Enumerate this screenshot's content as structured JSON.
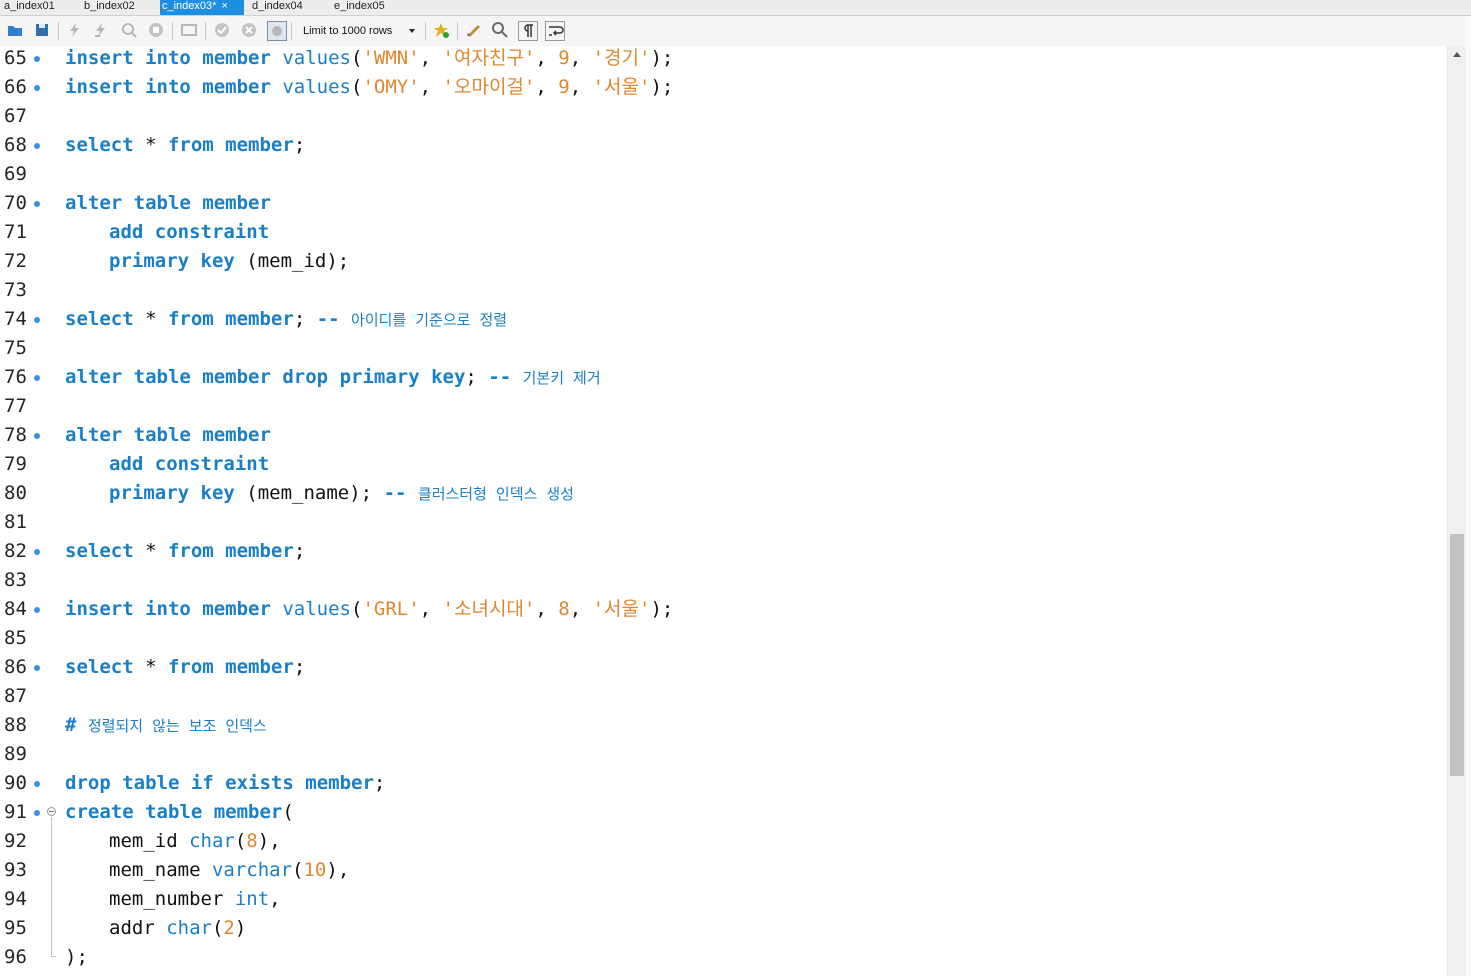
{
  "tabs": [
    {
      "label": "a_index01",
      "active": false
    },
    {
      "label": "b_index02",
      "active": false
    },
    {
      "label": "c_index03*",
      "active": true,
      "close": "×"
    },
    {
      "label": "d_index04",
      "active": false
    },
    {
      "label": "e_index05",
      "active": false
    }
  ],
  "toolbar": {
    "icons": [
      "open-folder-icon",
      "save-icon",
      "execute-icon",
      "execute-current-icon",
      "explain-icon",
      "stop-icon",
      "toggle-results-icon",
      "commit-icon",
      "rollback-icon",
      "autocommit-icon",
      "bookmark-icon",
      "beautify-icon",
      "find-icon",
      "invisible-chars-icon",
      "wrap-icon"
    ],
    "limit_label": "Limit to 1000 rows"
  },
  "editor": {
    "lines": [
      {
        "n": "65",
        "marker": true,
        "tokens": [
          [
            "kw",
            "insert "
          ],
          [
            "kw",
            "into "
          ],
          [
            "kw",
            "member "
          ],
          [
            "fn",
            "values"
          ],
          [
            "pl",
            "("
          ],
          [
            "str",
            "'WMN'"
          ],
          [
            "pl",
            ", "
          ],
          [
            "str",
            "'여자친구'"
          ],
          [
            "pl",
            ", "
          ],
          [
            "num",
            "9"
          ],
          [
            "pl",
            ", "
          ],
          [
            "str",
            "'경기'"
          ],
          [
            "pl",
            ");"
          ]
        ]
      },
      {
        "n": "66",
        "marker": true,
        "tokens": [
          [
            "kw",
            "insert "
          ],
          [
            "kw",
            "into "
          ],
          [
            "kw",
            "member "
          ],
          [
            "fn",
            "values"
          ],
          [
            "pl",
            "("
          ],
          [
            "str",
            "'OMY'"
          ],
          [
            "pl",
            ", "
          ],
          [
            "str",
            "'오마이걸'"
          ],
          [
            "pl",
            ", "
          ],
          [
            "num",
            "9"
          ],
          [
            "pl",
            ", "
          ],
          [
            "str",
            "'서울'"
          ],
          [
            "pl",
            ");"
          ]
        ]
      },
      {
        "n": "67",
        "marker": false,
        "tokens": []
      },
      {
        "n": "68",
        "marker": true,
        "tokens": [
          [
            "kw",
            "select "
          ],
          [
            "pl",
            "* "
          ],
          [
            "kw",
            "from "
          ],
          [
            "kw",
            "member"
          ],
          [
            "pl",
            ";"
          ]
        ]
      },
      {
        "n": "69",
        "marker": false,
        "tokens": []
      },
      {
        "n": "70",
        "marker": true,
        "tokens": [
          [
            "kw",
            "alter "
          ],
          [
            "kw",
            "table "
          ],
          [
            "kw",
            "member"
          ]
        ]
      },
      {
        "n": "71",
        "marker": false,
        "indent": true,
        "tokens": [
          [
            "kw",
            "add "
          ],
          [
            "kw",
            "constraint"
          ]
        ]
      },
      {
        "n": "72",
        "marker": false,
        "indent": true,
        "tokens": [
          [
            "kw",
            "primary "
          ],
          [
            "kw",
            "key "
          ],
          [
            "pl",
            "(mem_id);"
          ]
        ]
      },
      {
        "n": "73",
        "marker": false,
        "tokens": []
      },
      {
        "n": "74",
        "marker": true,
        "tokens": [
          [
            "kw",
            "select "
          ],
          [
            "pl",
            "* "
          ],
          [
            "kw",
            "from "
          ],
          [
            "kw",
            "member"
          ],
          [
            "pl",
            "; "
          ],
          [
            "kw",
            "-- "
          ],
          [
            "cm",
            "아이디를 기준으로 정렬"
          ]
        ]
      },
      {
        "n": "75",
        "marker": false,
        "tokens": []
      },
      {
        "n": "76",
        "marker": true,
        "tokens": [
          [
            "kw",
            "alter "
          ],
          [
            "kw",
            "table "
          ],
          [
            "kw",
            "member "
          ],
          [
            "kw",
            "drop "
          ],
          [
            "kw",
            "primary "
          ],
          [
            "kw",
            "key"
          ],
          [
            "pl",
            "; "
          ],
          [
            "kw",
            "-- "
          ],
          [
            "cm",
            "기본키 제거"
          ]
        ]
      },
      {
        "n": "77",
        "marker": false,
        "tokens": []
      },
      {
        "n": "78",
        "marker": true,
        "tokens": [
          [
            "kw",
            "alter "
          ],
          [
            "kw",
            "table "
          ],
          [
            "kw",
            "member"
          ]
        ]
      },
      {
        "n": "79",
        "marker": false,
        "indent": true,
        "tokens": [
          [
            "kw",
            "add "
          ],
          [
            "kw",
            "constraint"
          ]
        ]
      },
      {
        "n": "80",
        "marker": false,
        "indent": true,
        "tokens": [
          [
            "kw",
            "primary "
          ],
          [
            "kw",
            "key "
          ],
          [
            "pl",
            "(mem_name); "
          ],
          [
            "kw",
            "-- "
          ],
          [
            "cm",
            "클러스터형 인덱스 생성"
          ]
        ]
      },
      {
        "n": "81",
        "marker": false,
        "tokens": []
      },
      {
        "n": "82",
        "marker": true,
        "tokens": [
          [
            "kw",
            "select "
          ],
          [
            "pl",
            "* "
          ],
          [
            "kw",
            "from "
          ],
          [
            "kw",
            "member"
          ],
          [
            "pl",
            ";"
          ]
        ]
      },
      {
        "n": "83",
        "marker": false,
        "tokens": []
      },
      {
        "n": "84",
        "marker": true,
        "tokens": [
          [
            "kw",
            "insert "
          ],
          [
            "kw",
            "into "
          ],
          [
            "kw",
            "member "
          ],
          [
            "fn",
            "values"
          ],
          [
            "pl",
            "("
          ],
          [
            "str",
            "'GRL'"
          ],
          [
            "pl",
            ", "
          ],
          [
            "str",
            "'소녀시대'"
          ],
          [
            "pl",
            ", "
          ],
          [
            "num",
            "8"
          ],
          [
            "pl",
            ", "
          ],
          [
            "str",
            "'서울'"
          ],
          [
            "pl",
            ");"
          ]
        ]
      },
      {
        "n": "85",
        "marker": false,
        "tokens": []
      },
      {
        "n": "86",
        "marker": true,
        "tokens": [
          [
            "kw",
            "select "
          ],
          [
            "pl",
            "* "
          ],
          [
            "kw",
            "from "
          ],
          [
            "kw",
            "member"
          ],
          [
            "pl",
            ";"
          ]
        ]
      },
      {
        "n": "87",
        "marker": false,
        "tokens": []
      },
      {
        "n": "88",
        "marker": false,
        "tokens": [
          [
            "kw",
            "# "
          ],
          [
            "cm",
            "정렬되지 않는 보조 인덱스"
          ]
        ]
      },
      {
        "n": "89",
        "marker": false,
        "tokens": []
      },
      {
        "n": "90",
        "marker": true,
        "tokens": [
          [
            "kw",
            "drop "
          ],
          [
            "kw",
            "table "
          ],
          [
            "kw",
            "if "
          ],
          [
            "kw",
            "exists "
          ],
          [
            "kw",
            "member"
          ],
          [
            "pl",
            ";"
          ]
        ]
      },
      {
        "n": "91",
        "marker": true,
        "fold": true,
        "tokens": [
          [
            "kw",
            "create "
          ],
          [
            "kw",
            "table "
          ],
          [
            "kw",
            "member"
          ],
          [
            "pl",
            "("
          ]
        ]
      },
      {
        "n": "92",
        "marker": false,
        "indent": true,
        "tokens": [
          [
            "pl",
            "mem_id "
          ],
          [
            "fn",
            "char"
          ],
          [
            "pl",
            "("
          ],
          [
            "num",
            "8"
          ],
          [
            "pl",
            "),"
          ]
        ]
      },
      {
        "n": "93",
        "marker": false,
        "indent": true,
        "tokens": [
          [
            "pl",
            "mem_name "
          ],
          [
            "fn",
            "varchar"
          ],
          [
            "pl",
            "("
          ],
          [
            "num",
            "10"
          ],
          [
            "pl",
            "),"
          ]
        ]
      },
      {
        "n": "94",
        "marker": false,
        "indent": true,
        "tokens": [
          [
            "pl",
            "mem_number "
          ],
          [
            "fn",
            "int"
          ],
          [
            "pl",
            ","
          ]
        ]
      },
      {
        "n": "95",
        "marker": false,
        "indent": true,
        "tokens": [
          [
            "pl",
            "addr "
          ],
          [
            "fn",
            "char"
          ],
          [
            "pl",
            "("
          ],
          [
            "num",
            "2"
          ],
          [
            "pl",
            ")"
          ]
        ]
      },
      {
        "n": "96",
        "marker": false,
        "tokens": [
          [
            "pl",
            ");"
          ]
        ]
      }
    ]
  },
  "scrollbar": {
    "position_fraction": 0.5
  }
}
